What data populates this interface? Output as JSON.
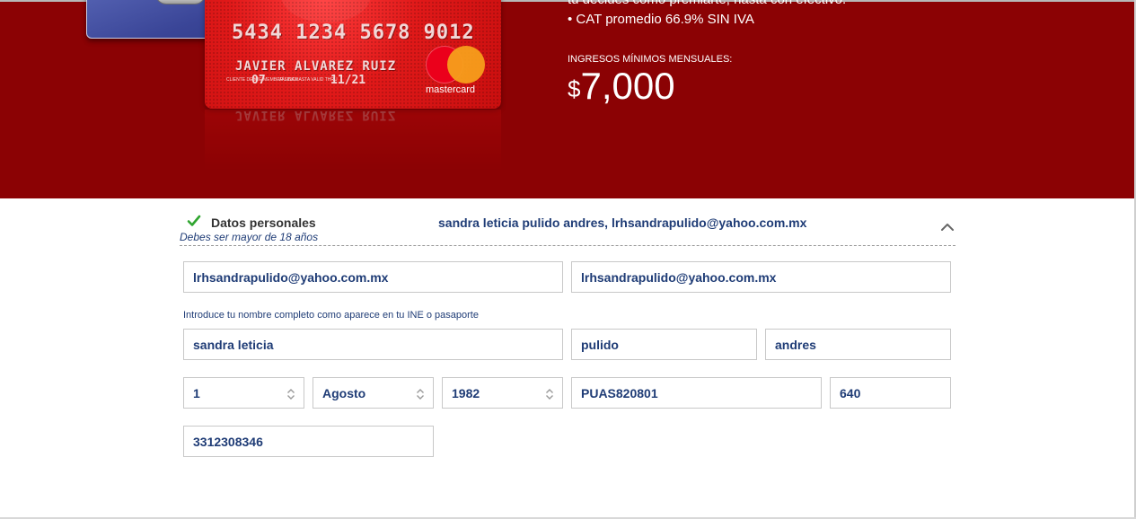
{
  "hero": {
    "partial_text": "tú decides como premiarte, hasta con efectivo.",
    "cat_line": "• CAT promedio 66.9% SIN IVA",
    "income_label": "INGRESOS MÍNIMOS MENSUALES:",
    "income_currency": "$",
    "income_amount": "7,000",
    "card": {
      "number": "5434 1234 5678 9012",
      "holder": "JAVIER ALVAREZ RUIZ",
      "since_label": "CLIENTE DESDE MEMBER SINCE",
      "since_value": "07",
      "valid_label": "VÁLIDA HASTA VALID THRU",
      "valid_value": "11/21",
      "brand": "mastercard"
    },
    "colors": {
      "banner": "#8b0204",
      "card": "#e01919"
    }
  },
  "section": {
    "title": "Datos personales",
    "subtitle": "Debes ser mayor de 18 años",
    "summary": "sandra leticia pulido andres, lrhsandrapulido@yahoo.com.mx",
    "status_icon": "check-icon",
    "toggle_icon": "chevron-up-icon"
  },
  "form": {
    "email": "lrhsandrapulido@yahoo.com.mx",
    "email_confirm": "lrhsandrapulido@yahoo.com.mx",
    "name_hint": "Introduce tu nombre completo como aparece en tu INE o pasaporte",
    "first_name": "sandra leticia",
    "last_name_1": "pulido",
    "last_name_2": "andres",
    "birth_day": "1",
    "birth_month": "Agosto",
    "birth_year": "1982",
    "rfc": "PUAS820801",
    "homoclave": "640",
    "phone": "3312308346"
  }
}
